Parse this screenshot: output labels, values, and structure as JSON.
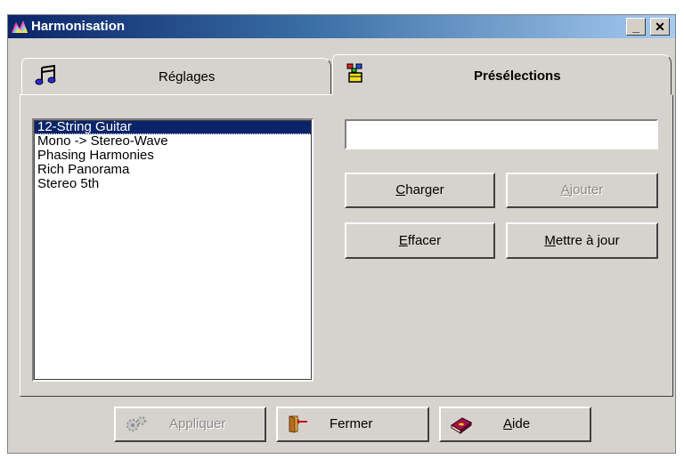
{
  "window": {
    "title": "Harmonisation"
  },
  "title_buttons": {
    "minimize": "_",
    "close": "✕"
  },
  "tabs": [
    {
      "label": "Réglages",
      "active": false,
      "icon": "music-notes-icon"
    },
    {
      "label": "Présélections",
      "active": true,
      "icon": "presets-icon"
    }
  ],
  "presets": {
    "items": [
      "12-String Guitar",
      "Mono -> Stereo-Wave",
      "Phasing Harmonies",
      "Rich Panorama",
      "Stereo 5th"
    ],
    "selected_index": 0,
    "name_value": ""
  },
  "preset_buttons": {
    "load": {
      "before": "",
      "mnemonic": "C",
      "after": "harger"
    },
    "add": {
      "before": "",
      "mnemonic": "A",
      "after": "jouter"
    },
    "delete": {
      "before": "",
      "mnemonic": "E",
      "after": "ffacer"
    },
    "update": {
      "before": "",
      "mnemonic": "M",
      "after": "ettre à jour"
    }
  },
  "footer_buttons": {
    "apply": {
      "label": "Appliquer"
    },
    "close": {
      "label": "Fermer"
    },
    "help": {
      "before": "",
      "mnemonic": "A",
      "after": "ide"
    }
  },
  "colors": {
    "title_bar_start": "#0a246a",
    "title_bar_end": "#a6caf0",
    "face": "#d6d3ce",
    "selection": "#0a246a"
  }
}
